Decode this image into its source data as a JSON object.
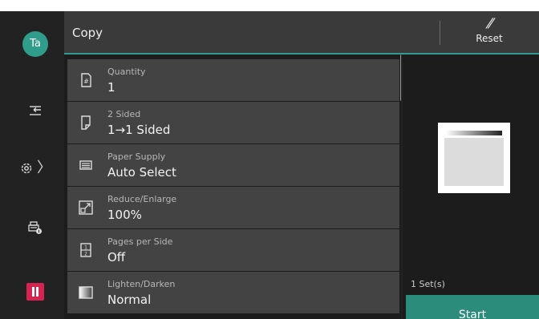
{
  "user": {
    "initials": "Ta"
  },
  "header": {
    "title": "Copy",
    "reset_label": "Reset",
    "accent_color": "#2f9c8c"
  },
  "rail": {
    "items": [
      {
        "icon": "job-flow-icon"
      },
      {
        "icon": "gear-icon",
        "chevron": "〉"
      },
      {
        "icon": "printer-info-icon"
      },
      {
        "icon": "pause-icon",
        "color": "#d4244f"
      }
    ]
  },
  "features": [
    {
      "icon": "quantity-icon",
      "label": "Quantity",
      "value": "1"
    },
    {
      "icon": "two-sided-icon",
      "label": "2 Sided",
      "value": "1→1 Sided"
    },
    {
      "icon": "paper-supply-icon",
      "label": "Paper Supply",
      "value": "Auto Select"
    },
    {
      "icon": "reduce-enlarge-icon",
      "label": "Reduce/Enlarge",
      "value": "100%"
    },
    {
      "icon": "pages-per-side-icon",
      "label": "Pages per Side",
      "value": "Off"
    },
    {
      "icon": "lighten-darken-icon",
      "label": "Lighten/Darken",
      "value": "Normal"
    }
  ],
  "preview": {
    "sets_label": "1 Set(s)",
    "start_label": "Start"
  }
}
